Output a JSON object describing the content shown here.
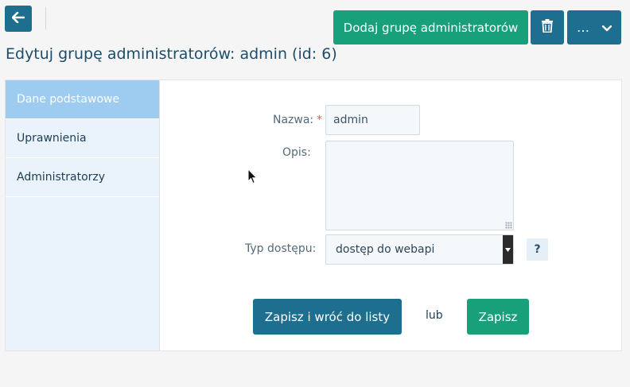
{
  "toolbar": {
    "back_icon": "arrow-left-icon",
    "add_group_label": "Dodaj grupę administratorów",
    "delete_icon": "trash-icon",
    "more_label": "…",
    "more_icon": "chevron-down-icon"
  },
  "page_title": "Edytuj grupę administratorów: admin (id: 6)",
  "sidebar": {
    "items": [
      {
        "label": "Dane podstawowe",
        "active": true
      },
      {
        "label": "Uprawnienia",
        "active": false
      },
      {
        "label": "Administratorzy",
        "active": false
      }
    ]
  },
  "form": {
    "name": {
      "label": "Nazwa:",
      "required_mark": "*",
      "value": "admin"
    },
    "description": {
      "label": "Opis:",
      "value": ""
    },
    "access_type": {
      "label": "Typ dostępu:",
      "value": "dostęp do webapi",
      "help": "?"
    }
  },
  "actions": {
    "save_return_label": "Zapisz i wróć do listy",
    "or_label": "lub",
    "save_label": "Zapisz"
  },
  "colors": {
    "primary": "#1e6f8f",
    "success": "#18a07a",
    "sidebar_active": "#9ecbf0",
    "required": "#e05a4f"
  }
}
